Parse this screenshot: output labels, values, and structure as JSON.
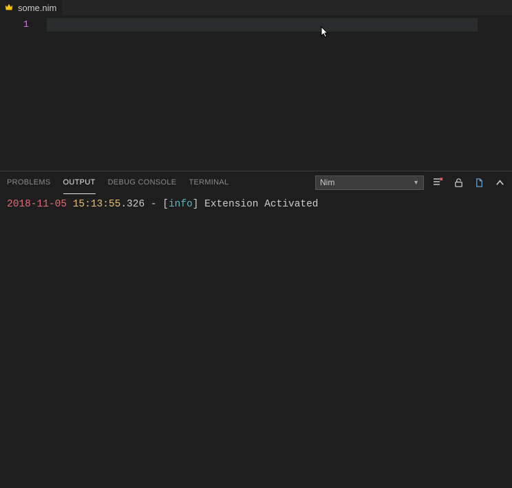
{
  "tab": {
    "filename": "some.nim"
  },
  "editor": {
    "lines": [
      {
        "n": "1"
      }
    ]
  },
  "panel": {
    "tabs": {
      "problems": "PROBLEMS",
      "output": "OUTPUT",
      "debugConsole": "DEBUG CONSOLE",
      "terminal": "TERMINAL"
    },
    "channel": {
      "selected": "Nim"
    }
  },
  "output": {
    "date": "2018-11-05",
    "time": "15:13:55",
    "ms_dash_bracket": ".326 - [",
    "level": "info",
    "tail": "] Extension Activated"
  }
}
